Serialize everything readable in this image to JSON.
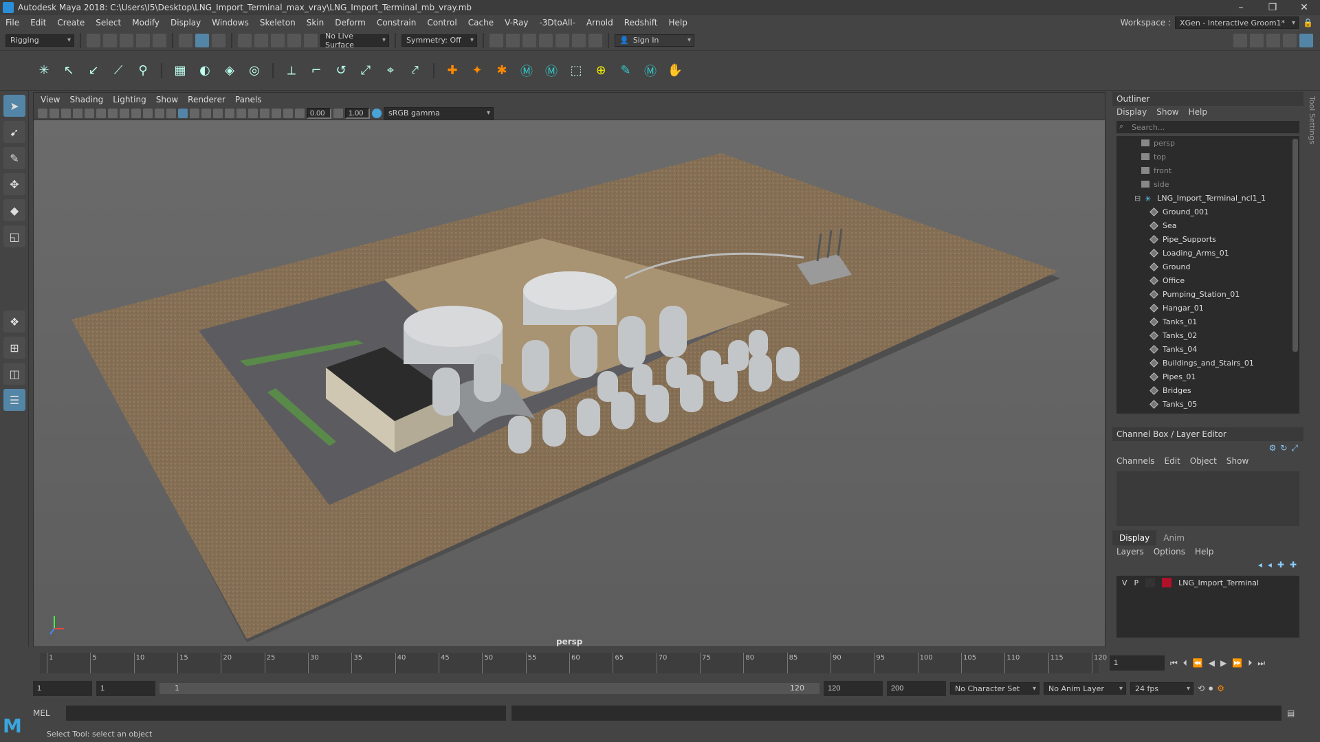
{
  "window": {
    "title": "Autodesk Maya 2018: C:\\Users\\I5\\Desktop\\LNG_Import_Terminal_max_vray\\LNG_Import_Terminal_mb_vray.mb",
    "controls": [
      "–",
      "❐",
      "✕"
    ]
  },
  "menubar": {
    "items": [
      "File",
      "Edit",
      "Create",
      "Select",
      "Modify",
      "Display",
      "Windows",
      "Skeleton",
      "Skin",
      "Deform",
      "Constrain",
      "Control",
      "Cache",
      "V-Ray",
      "-3DtoAll-",
      "Arnold",
      "Redshift",
      "Help"
    ],
    "workspace_label": "Workspace :",
    "workspace_value": "XGen - Interactive Groom1*"
  },
  "statusline": {
    "menuset": "Rigging",
    "live_surface": "No Live Surface",
    "symmetry": "Symmetry: Off",
    "sign_in": "Sign In"
  },
  "viewport": {
    "menus": [
      "View",
      "Shading",
      "Lighting",
      "Show",
      "Renderer",
      "Panels"
    ],
    "exposure": "0.00",
    "gamma": "1.00",
    "color_space": "sRGB gamma",
    "camera_label": "persp"
  },
  "outliner": {
    "title": "Outliner",
    "menus": [
      "Display",
      "Show",
      "Help"
    ],
    "search_placeholder": "Search...",
    "cameras": [
      "persp",
      "top",
      "front",
      "side"
    ],
    "root": "LNG_Import_Terminal_ncl1_1",
    "children": [
      "Ground_001",
      "Sea",
      "Pipe_Supports",
      "Loading_Arms_01",
      "Ground",
      "Office",
      "Pumping_Station_01",
      "Hangar_01",
      "Tanks_01",
      "Tanks_02",
      "Tanks_04",
      "Buildings_and_Stairs_01",
      "Pipes_01",
      "Bridges",
      "Tanks_05"
    ]
  },
  "channelbox": {
    "title": "Channel Box / Layer Editor",
    "menus": [
      "Channels",
      "Edit",
      "Object",
      "Show"
    ]
  },
  "layereditor": {
    "tabs": [
      "Display",
      "Anim"
    ],
    "menus": [
      "Layers",
      "Options",
      "Help"
    ],
    "layer": {
      "v": "V",
      "p": "P",
      "name": "LNG_Import_Terminal",
      "color": "#b01028"
    }
  },
  "timeslider": {
    "ticks": [
      "1",
      "5",
      "10",
      "15",
      "20",
      "25",
      "30",
      "35",
      "40",
      "45",
      "50",
      "55",
      "60",
      "65",
      "70",
      "75",
      "80",
      "85",
      "90",
      "95",
      "100",
      "105",
      "110",
      "115",
      "120"
    ],
    "current_frame": "1"
  },
  "rangeslider": {
    "start": "1",
    "inner_start": "1",
    "bar_start": "1",
    "bar_end": "120",
    "inner_end": "120",
    "end": "200",
    "character_set": "No Character Set",
    "anim_layer": "No Anim Layer",
    "fps": "24 fps"
  },
  "cmdline": {
    "label": "MEL"
  },
  "helpline": {
    "text": "Select Tool: select an object"
  },
  "sidetab": {
    "label": "Tool Settings"
  }
}
